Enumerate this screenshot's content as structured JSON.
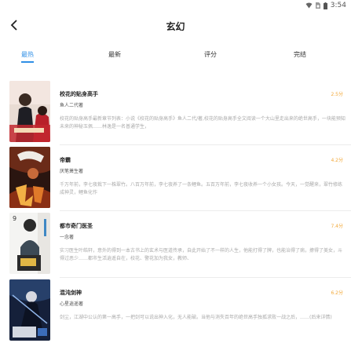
{
  "status_bar": {
    "icons": [
      "wifi-icon",
      "sim-icon",
      "battery-icon"
    ],
    "time": "3:54"
  },
  "app_bar": {
    "back_icon": "chevron-left-icon",
    "title": "玄幻"
  },
  "tabs": [
    {
      "label": "最热",
      "active": true
    },
    {
      "label": "最新",
      "active": false
    },
    {
      "label": "评分",
      "active": false
    },
    {
      "label": "完结",
      "active": false
    }
  ],
  "colors": {
    "accent": "#2f8fe6",
    "score": "#f2a93b",
    "desc": "#a9a9a9"
  },
  "books": [
    {
      "title": "校花的贴身高手",
      "author": "鱼人二代著",
      "score": "2.5分",
      "description": "校花的贴身高手最新章节列表：小说《校花的贴身高手》鱼人二代/著,校花的贴身高手全文阅读一个大山里走出来的绝世高手，一块能预知未来的神秘玉佩……林逸是一名普通学生，"
    },
    {
      "title": "帝霸",
      "author": "厌笔萧生著",
      "score": "4.2分",
      "description": "千万年前，李七夜栽下一株翠竹。八百万年前，李七夜养了一条鲤鱼。五百万年前，李七夜收养一个小女孩。今天，一觉醒来，翠竹修练成神灵，鲤鱼化作"
    },
    {
      "title": "都市奇门医圣",
      "author": "一念著",
      "score": "7.4分",
      "description": "实习医生叶皓轩，意外的得到一本古书上的玄术与医道传承，自此开始了不一样的人生，他能打得了牌，也能治得了病，撩得了美女，斗得过恶少……都市生活逍遥自在，校花、警花加为我女，教师、"
    },
    {
      "title": "混沌剑神",
      "author": "心星逍遥著",
      "score": "6.2分",
      "description": "剑尘，江湖中公认的第一高手，一把剑可以说出神入化，无人能破。当他与消失百年的绝世高手独孤求败一战之后，……(后来详情)"
    }
  ]
}
